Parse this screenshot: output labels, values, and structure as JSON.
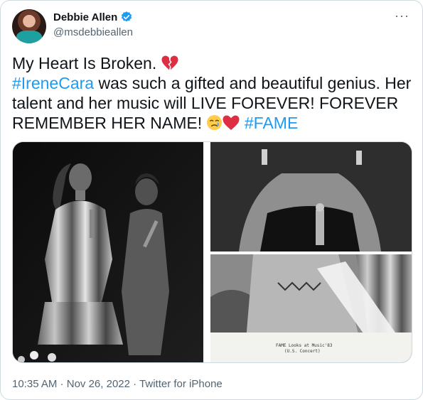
{
  "author": {
    "name": "Debbie Allen",
    "handle": "@msdebbieallen",
    "verified": true
  },
  "menu": {
    "icon": "more-horizontal-icon",
    "label": "···"
  },
  "tweet": {
    "line1": "My Heart Is Broken.",
    "hashtag_irene": "#IreneCara",
    "line2_rest": " was such a gifted and beautiful genius. Her",
    "line3": "talent and her music will LIVE FOREVER! FOREVER",
    "line4": "REMEMBER HER NAME!",
    "hashtag_fame": "#FAME"
  },
  "media": {
    "photo_caption_line1": "FAME Looks at Music'83",
    "photo_caption_line2": "(U.S. Concert)"
  },
  "footer": {
    "time": "10:35 AM",
    "date": "Nov 26, 2022",
    "source": "Twitter for iPhone",
    "separator": " · "
  },
  "colors": {
    "link": "#1d9bf0",
    "verified": "#1d9bf0",
    "secondary_text": "#536471"
  }
}
